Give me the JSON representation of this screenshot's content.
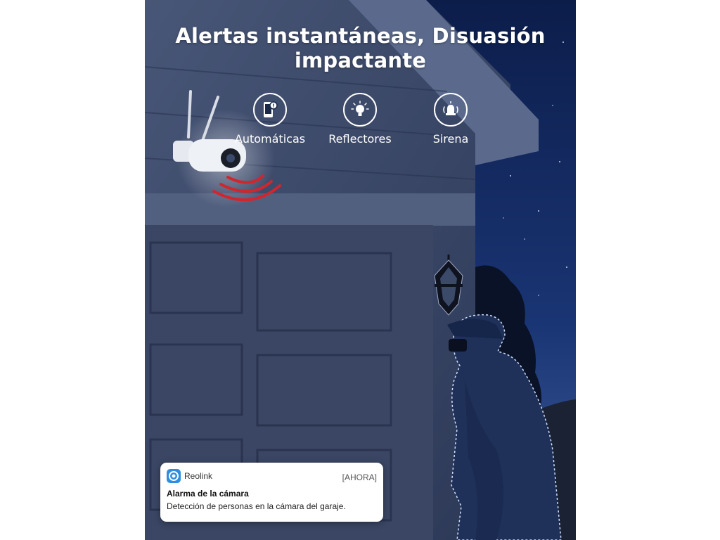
{
  "headline": {
    "line1": "Alertas instantáneas, Disuasión",
    "line2": "impactante"
  },
  "features": [
    {
      "label": "Automáticas",
      "icon": "phone-alert-icon"
    },
    {
      "label": "Reflectores",
      "icon": "lightbulb-icon"
    },
    {
      "label": "Sirena",
      "icon": "siren-bell-icon"
    }
  ],
  "notification": {
    "app": "Reolink",
    "time": "[AHORA]",
    "title": "Alarma de la cámara",
    "body": "Detección de personas en la cámara del garaje."
  },
  "colors": {
    "sky": "#14275a",
    "wall": "#3a4868",
    "siren_waves": "#d0262e",
    "outline": "#cfe0ff"
  }
}
